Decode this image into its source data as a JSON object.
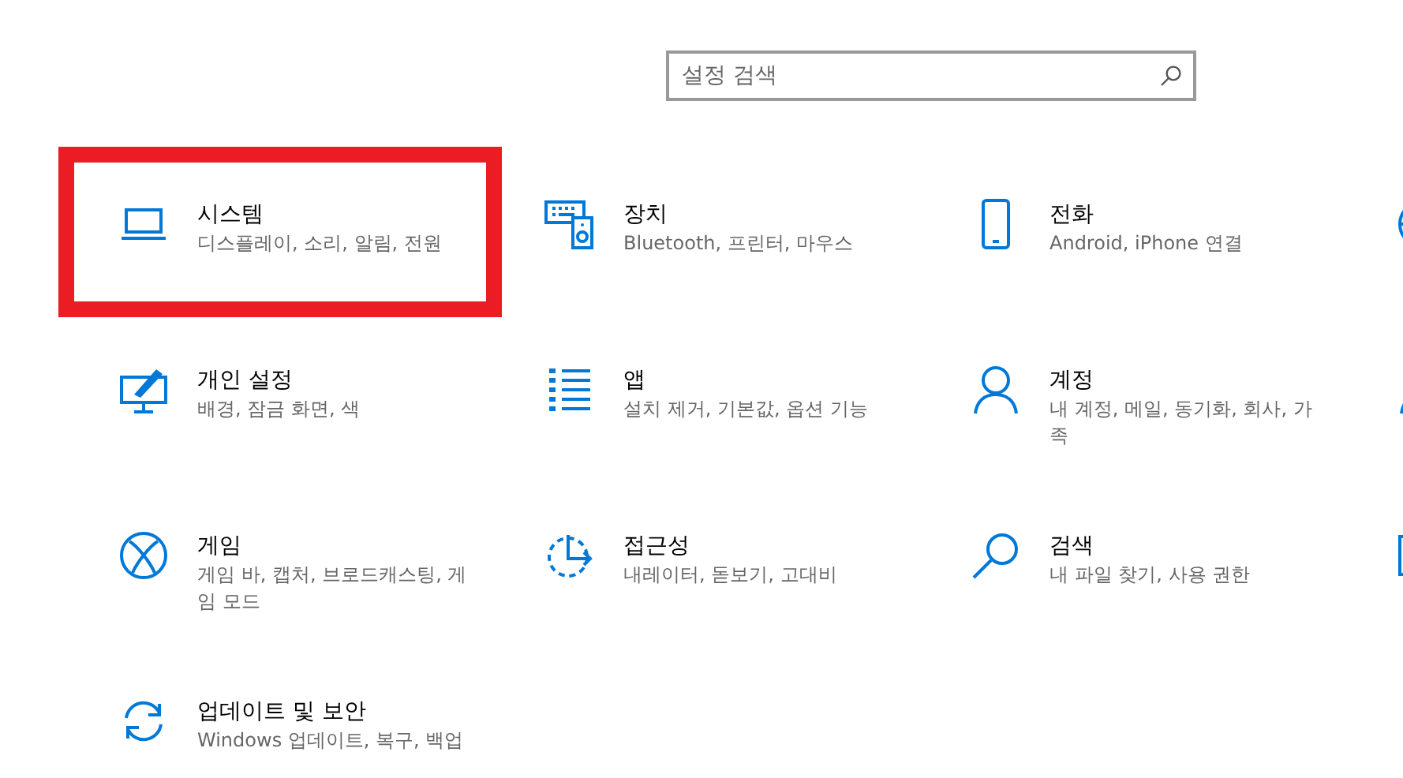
{
  "search": {
    "placeholder": "설정 검색"
  },
  "tiles": [
    {
      "title": "시스템",
      "subtitle": "디스플레이, 소리, 알림, 전원",
      "highlighted": true
    },
    {
      "title": "장치",
      "subtitle": "Bluetooth, 프린터, 마우스",
      "highlighted": false
    },
    {
      "title": "전화",
      "subtitle": "Android, iPhone 연결",
      "highlighted": false
    },
    {
      "title": "개인 설정",
      "subtitle": "배경, 잠금 화면, 색",
      "highlighted": false
    },
    {
      "title": "앱",
      "subtitle": "설치 제거, 기본값, 옵션 기능",
      "highlighted": false
    },
    {
      "title": "계정",
      "subtitle": "내 계정, 메일, 동기화, 회사, 가족",
      "highlighted": false
    },
    {
      "title": "게임",
      "subtitle": "게임 바, 캡처, 브로드캐스팅, 게임 모드",
      "highlighted": false
    },
    {
      "title": "접근성",
      "subtitle": "내레이터, 돋보기, 고대비",
      "highlighted": false
    },
    {
      "title": "검색",
      "subtitle": "내 파일 찾기, 사용 권한",
      "highlighted": false
    },
    {
      "title": "업데이트 및 보안",
      "subtitle": "Windows 업데이트, 복구, 백업",
      "highlighted": false
    }
  ]
}
